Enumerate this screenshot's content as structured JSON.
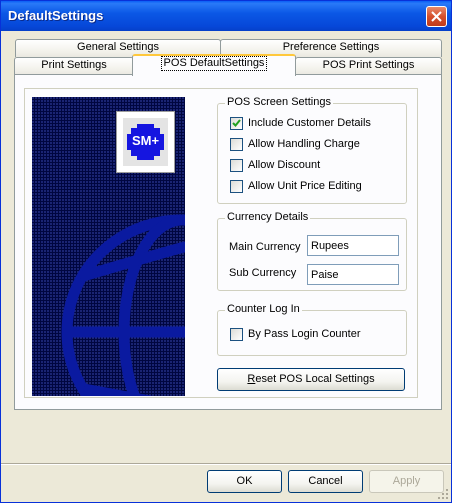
{
  "window": {
    "title": "DefaultSettings"
  },
  "tabs": {
    "row1": [
      {
        "label": "General Settings"
      },
      {
        "label": "Preference Settings"
      }
    ],
    "row2": [
      {
        "label": "Print Settings"
      },
      {
        "label": "POS DefaultSettings",
        "active": true
      },
      {
        "label": "POS Print Settings"
      }
    ]
  },
  "logo": {
    "text": "SM+"
  },
  "pos_screen": {
    "title": "POS Screen Settings",
    "options": [
      {
        "label": "Include Customer Details",
        "checked": true
      },
      {
        "label": "Allow Handling Charge",
        "checked": false
      },
      {
        "label": "Allow Discount",
        "checked": false
      },
      {
        "label": "Allow Unit Price Editing",
        "checked": false
      }
    ]
  },
  "currency": {
    "title": "Currency Details",
    "main_label": "Main Currency",
    "main_value": "Rupees",
    "sub_label": "Sub Currency",
    "sub_value": "Paise"
  },
  "counter": {
    "title": "Counter Log In",
    "bypass_label": "By Pass Login Counter",
    "bypass_checked": false
  },
  "reset_button": {
    "label": "Reset POS Local Settings",
    "mnemonic": "R",
    "rest": "eset POS Local Settings"
  },
  "footer": {
    "ok": "OK",
    "cancel": "Cancel",
    "apply": "Apply"
  },
  "colors": {
    "title_bar": "#0b58e6",
    "logo_background": "#000640",
    "globe": "#0a1aa0",
    "badge_blue": "#1515e0"
  }
}
